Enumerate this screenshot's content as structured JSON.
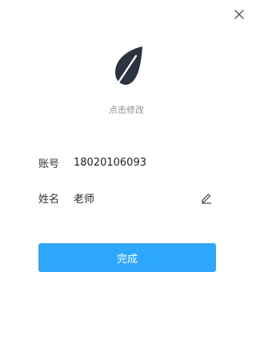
{
  "dialog": {
    "close_icon": "close-icon"
  },
  "avatar": {
    "icon": "feather-leaf-icon",
    "color": "#2b3440",
    "hint": "点击修改"
  },
  "fields": {
    "account": {
      "label": "账号",
      "value": "18020106093"
    },
    "name": {
      "label": "姓名",
      "value": "老师",
      "edit_icon": "pencil-icon"
    }
  },
  "actions": {
    "done_label": "完成",
    "done_color": "#2ea6fb"
  }
}
